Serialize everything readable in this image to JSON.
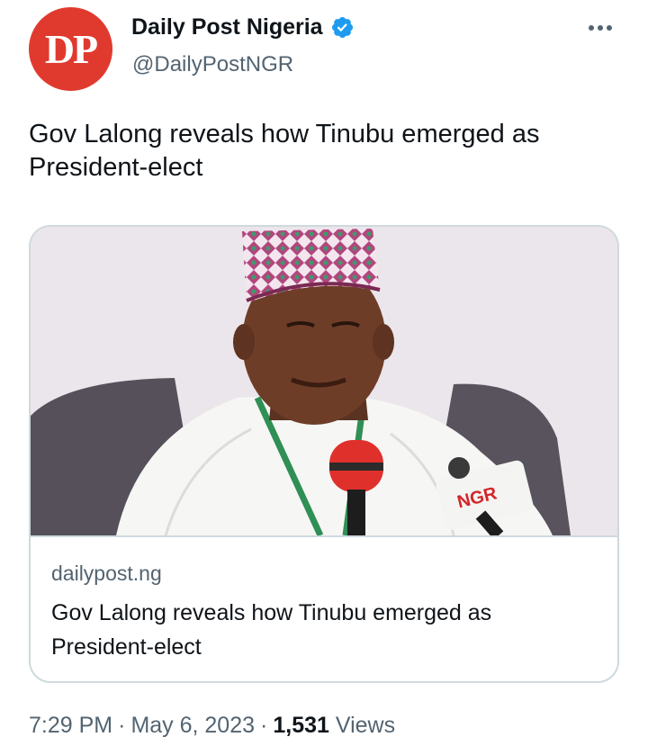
{
  "author": {
    "display_name": "Daily Post Nigeria",
    "handle": "@DailyPostNGR",
    "avatar_text": "DP",
    "verified": true
  },
  "tweet": {
    "text": "Gov Lalong reveals how Tinubu emerged as President-elect"
  },
  "card": {
    "domain": "dailypost.ng",
    "title": "Gov Lalong reveals how Tinubu emerged as President-elect",
    "image_label": "NGR"
  },
  "meta": {
    "time": "7:29 PM",
    "separator": "·",
    "date": "May 6, 2023",
    "views_count": "1,531",
    "views_label": "Views"
  },
  "colors": {
    "brand_red": "#e03a2f",
    "verified_blue": "#1d9bf0",
    "secondary_text": "#536471",
    "primary_text": "#0f1419",
    "border": "#cfd9de"
  }
}
